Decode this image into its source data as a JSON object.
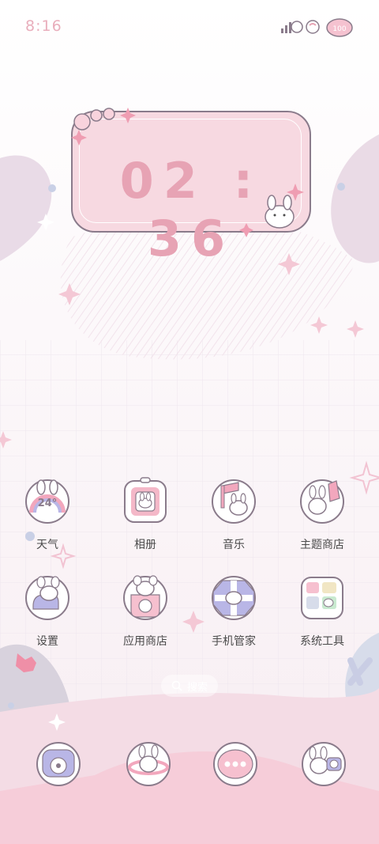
{
  "status": {
    "time": "8:16",
    "icons": [
      "signal-icon",
      "wifi-icon",
      "battery-icon"
    ],
    "battery_label": "100"
  },
  "clock_widget": {
    "time": "02 : 36"
  },
  "apps": [
    {
      "label": "天气",
      "icon": "weather-icon",
      "temperature": "24°"
    },
    {
      "label": "相册",
      "icon": "gallery-icon"
    },
    {
      "label": "音乐",
      "icon": "music-icon"
    },
    {
      "label": "主题商店",
      "icon": "theme-store-icon"
    },
    {
      "label": "设置",
      "icon": "settings-icon"
    },
    {
      "label": "应用商店",
      "icon": "app-store-icon"
    },
    {
      "label": "手机管家",
      "icon": "phone-manager-icon"
    },
    {
      "label": "系统工具",
      "icon": "system-tools-icon"
    }
  ],
  "search": {
    "label": "搜索"
  },
  "dock": [
    {
      "icon": "phone-icon"
    },
    {
      "icon": "browser-icon"
    },
    {
      "icon": "messages-icon"
    },
    {
      "icon": "camera-icon"
    }
  ],
  "colors": {
    "accent_pink": "#e7a3b4",
    "lavender": "#b9b6e6",
    "outline": "#8a7b8b"
  }
}
